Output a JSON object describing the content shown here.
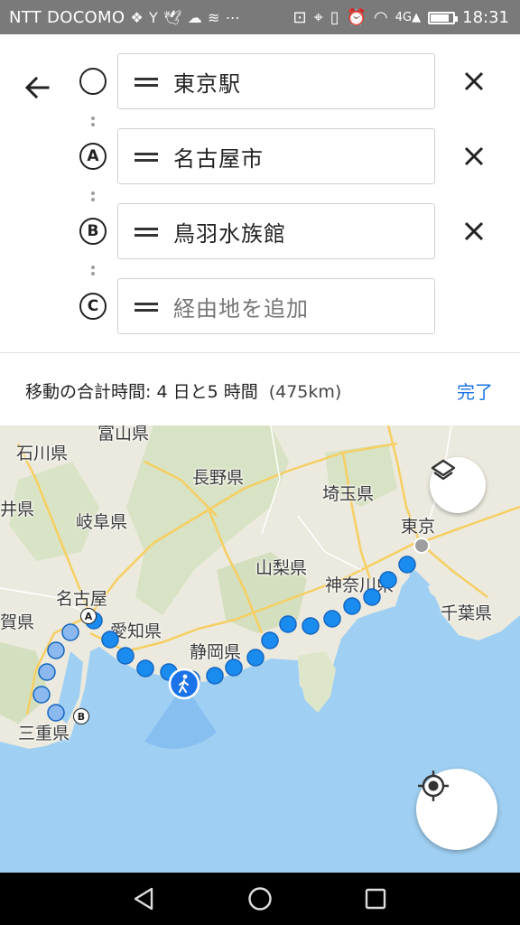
{
  "status_bar": {
    "carrier": "NTT DOCOMO",
    "time": "18:31",
    "network": "4G",
    "battery_level": 0.85
  },
  "directions": {
    "back_icon": "arrow-left-icon",
    "stops": [
      {
        "marker": "",
        "label": "東京駅",
        "is_placeholder": false,
        "removable": true
      },
      {
        "marker": "A",
        "label": "名古屋市",
        "is_placeholder": false,
        "removable": true
      },
      {
        "marker": "B",
        "label": "鳥羽水族館",
        "is_placeholder": false,
        "removable": true
      },
      {
        "marker": "C",
        "label": "経由地を追加",
        "is_placeholder": true,
        "removable": false
      }
    ]
  },
  "summary": {
    "total_time": "移動の合計時間: 4 日と5 時間",
    "distance": "(475km)",
    "done_label": "完了"
  },
  "map": {
    "labels": {
      "ishikawa": "石川県",
      "toyama": "富山県",
      "fukui": "井県",
      "gifu": "岐阜県",
      "nagano": "長野県",
      "saitama": "埼玉県",
      "tokyo": "東京",
      "yamanashi": "山梨県",
      "kanagawa": "神奈川県",
      "chiba": "千葉県",
      "nagoya": "名古屋",
      "aichi": "愛知県",
      "shizuoka": "静岡県",
      "shiga": "賀県",
      "mie": "三重県"
    },
    "route_markers": {
      "a": "A",
      "b": "B"
    },
    "travel_mode_icon": "walking-person-icon",
    "colors": {
      "water": "#9fd0f3",
      "land": "#eceade",
      "route": "#1a8cf0",
      "route_faded": "#8ab8ef"
    }
  },
  "nav_bar": {
    "back_icon": "triangle-back-icon",
    "home_icon": "circle-home-icon",
    "recents_icon": "square-recents-icon"
  }
}
